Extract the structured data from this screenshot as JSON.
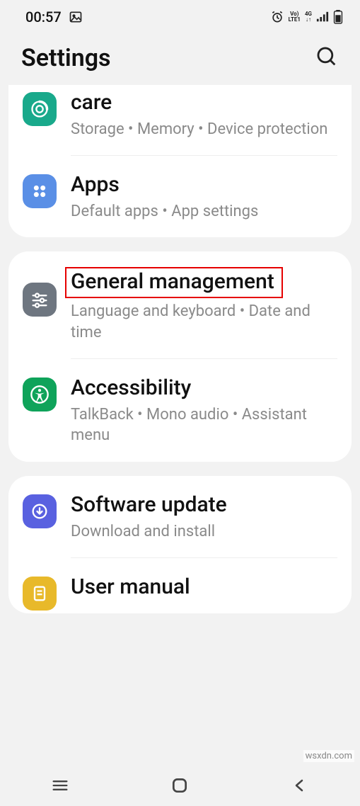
{
  "statusbar": {
    "time": "00:57"
  },
  "header": {
    "title": "Settings"
  },
  "groups": [
    {
      "items": [
        {
          "title": "care",
          "subtitle": "Storage  •  Memory  •  Device protection",
          "icon": "device-care",
          "color": "#19a98b"
        },
        {
          "title": "Apps",
          "subtitle": "Default apps  •  App settings",
          "icon": "apps",
          "color": "#5a8fe6"
        }
      ]
    },
    {
      "items": [
        {
          "title": "General management",
          "subtitle": "Language and keyboard  •  Date and time",
          "icon": "general",
          "color": "#6e7680",
          "highlight": true
        },
        {
          "title": "Accessibility",
          "subtitle": "TalkBack  •  Mono audio  •  Assistant menu",
          "icon": "accessibility",
          "color": "#0fa35a"
        }
      ]
    },
    {
      "items": [
        {
          "title": "Software update",
          "subtitle": "Download and install",
          "icon": "update",
          "color": "#5961e0"
        },
        {
          "title": "User manual",
          "subtitle": "",
          "icon": "manual",
          "color": "#e8b92a"
        }
      ]
    }
  ],
  "watermark": "wsxdn.com"
}
